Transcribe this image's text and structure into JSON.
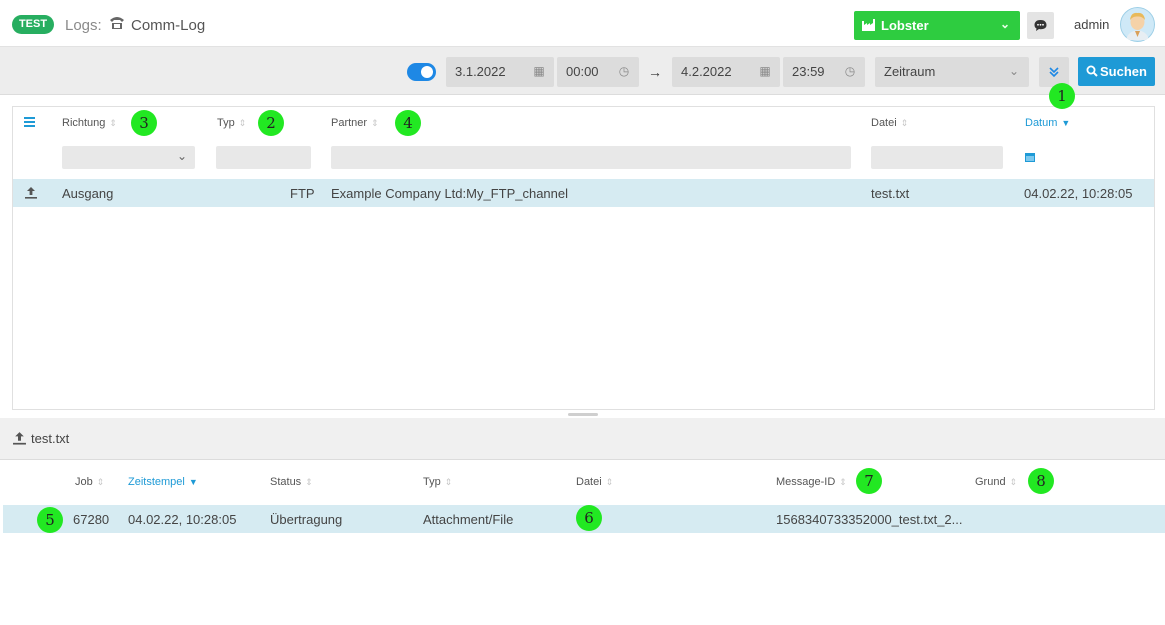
{
  "header": {
    "env_badge": "TEST",
    "breadcrumb_label": "Logs:",
    "title": "Comm-Log",
    "company": "Lobster",
    "user": "admin"
  },
  "filters": {
    "date_from": "3.1.2022",
    "time_from": "00:00",
    "date_to": "4.2.2022",
    "time_to": "23:59",
    "range": "Zeitraum",
    "search_label": "Suchen"
  },
  "top_table": {
    "columns": {
      "direction": "Richtung",
      "type": "Typ",
      "partner": "Partner",
      "file": "Datei",
      "date": "Datum"
    },
    "rows": [
      {
        "direction": "Ausgang",
        "type": "FTP",
        "partner": "Example Company Ltd:My_FTP_channel",
        "file": "test.txt",
        "date": "04.02.22, 10:28:05"
      }
    ]
  },
  "detail": {
    "title": "test.txt",
    "columns": {
      "job": "Job",
      "timestamp": "Zeitstempel",
      "status": "Status",
      "type": "Typ",
      "file": "Datei",
      "message_id": "Message-ID",
      "reason": "Grund"
    },
    "rows": [
      {
        "job": "67280",
        "timestamp": "04.02.22, 10:28:05",
        "status": "Übertragung",
        "type": "Attachment/File",
        "file": "",
        "message_id": "1568340733352000_test.txt_2...",
        "reason": ""
      }
    ]
  },
  "markers": [
    "1",
    "2",
    "3",
    "4",
    "5",
    "6",
    "7",
    "8"
  ],
  "colors": {
    "accent": "#1e9ad6",
    "brand_green": "#2ecc40",
    "selected_row": "#d6ebf2",
    "marker": "#22e822"
  }
}
